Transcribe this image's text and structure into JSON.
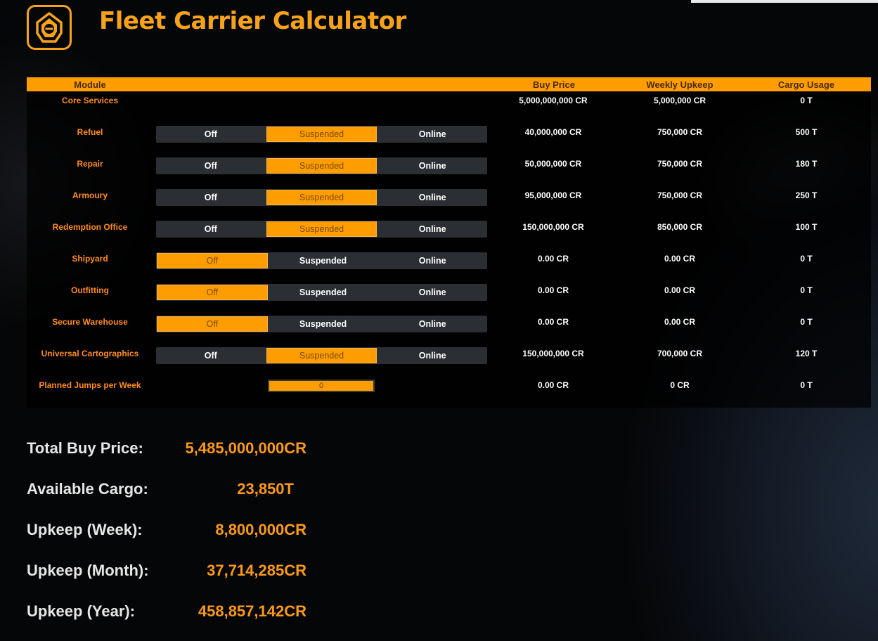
{
  "app": {
    "title": "Fleet Carrier Calculator"
  },
  "table": {
    "headers": {
      "module": "Module",
      "buy_price": "Buy Price",
      "weekly_upkeep": "Weekly Upkeep",
      "cargo_usage": "Cargo Usage"
    },
    "core": {
      "name": "Core Services",
      "buy": "5,000,000,000 CR",
      "upkeep": "5,000,000 CR",
      "cargo": "0 T"
    },
    "toggle_labels": {
      "off": "Off",
      "suspended": "Suspended",
      "online": "Online"
    },
    "rows": [
      {
        "name": "Refuel",
        "state": "suspended",
        "buy": "40,000,000 CR",
        "upkeep": "750,000 CR",
        "cargo": "500 T"
      },
      {
        "name": "Repair",
        "state": "suspended",
        "buy": "50,000,000 CR",
        "upkeep": "750,000 CR",
        "cargo": "180 T"
      },
      {
        "name": "Armoury",
        "state": "suspended",
        "buy": "95,000,000 CR",
        "upkeep": "750,000 CR",
        "cargo": "250 T"
      },
      {
        "name": "Redemption Office",
        "state": "suspended",
        "buy": "150,000,000 CR",
        "upkeep": "850,000 CR",
        "cargo": "100 T"
      },
      {
        "name": "Shipyard",
        "state": "off",
        "buy": "0.00 CR",
        "upkeep": "0.00 CR",
        "cargo": "0 T"
      },
      {
        "name": "Outfitting",
        "state": "off",
        "buy": "0.00 CR",
        "upkeep": "0.00 CR",
        "cargo": "0 T"
      },
      {
        "name": "Secure Warehouse",
        "state": "off",
        "buy": "0.00 CR",
        "upkeep": "0.00 CR",
        "cargo": "0 T"
      },
      {
        "name": "Universal Cartographics",
        "state": "suspended",
        "buy": "150,000,000 CR",
        "upkeep": "700,000 CR",
        "cargo": "120 T"
      }
    ],
    "jumps": {
      "name": "Planned Jumps per Week",
      "value": "0",
      "buy": "0.00 CR",
      "upkeep": "0 CR",
      "cargo": "0 T"
    }
  },
  "summary": [
    {
      "label": "Total Buy Price:",
      "value": "5,485,000,000",
      "unit": "CR"
    },
    {
      "label": "Available Cargo:",
      "value": "23,850",
      "unit": "T"
    },
    {
      "label": "Upkeep (Week):",
      "value": "8,800,000",
      "unit": "CR"
    },
    {
      "label": "Upkeep (Month):",
      "value": "37,714,285",
      "unit": "CR"
    },
    {
      "label": "Upkeep (Year):",
      "value": "458,857,142",
      "unit": "CR"
    }
  ],
  "colors": {
    "accent": "#fe9d00",
    "title": "#f7a21b",
    "module_name": "#ff8c22",
    "toggle_bg": "#2b2e33"
  },
  "icons": {
    "logo": "fleet-carrier-logo-icon"
  }
}
